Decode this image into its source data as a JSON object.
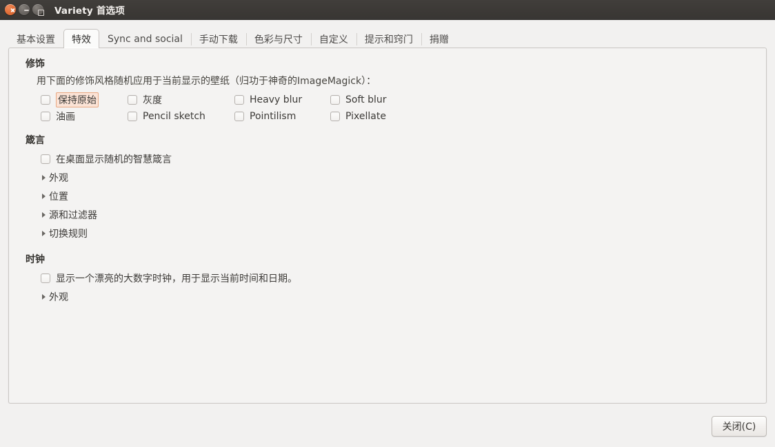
{
  "window": {
    "title": "Variety 首选项",
    "controls": {
      "close": "close-icon",
      "minimize": "minimize-icon",
      "maximize": "maximize-icon"
    }
  },
  "tabs": [
    {
      "label": "基本设置",
      "active": false
    },
    {
      "label": "特效",
      "active": true
    },
    {
      "label": "Sync and social",
      "active": false
    },
    {
      "label": "手动下载",
      "active": false
    },
    {
      "label": "色彩与尺寸",
      "active": false
    },
    {
      "label": "自定义",
      "active": false
    },
    {
      "label": "提示和窍门",
      "active": false
    },
    {
      "label": "捐赠",
      "active": false
    }
  ],
  "sections": {
    "filters": {
      "title": "修饰",
      "description": "用下面的修饰风格随机应用于当前显示的壁纸（归功于神奇的ImageMagick）：",
      "options": [
        {
          "label": "保持原始",
          "checked": false,
          "focused": true
        },
        {
          "label": "灰度",
          "checked": false,
          "focused": false
        },
        {
          "label": "Heavy blur",
          "checked": false,
          "focused": false
        },
        {
          "label": "Soft blur",
          "checked": false,
          "focused": false
        },
        {
          "label": "油画",
          "checked": false,
          "focused": false
        },
        {
          "label": "Pencil sketch",
          "checked": false,
          "focused": false
        },
        {
          "label": "Pointilism",
          "checked": false,
          "focused": false
        },
        {
          "label": "Pixellate",
          "checked": false,
          "focused": false
        }
      ]
    },
    "quotes": {
      "title": "箴言",
      "checkbox": {
        "label": "在桌面显示随机的智慧箴言",
        "checked": false
      },
      "expanders": [
        {
          "label": "外观",
          "expanded": false
        },
        {
          "label": "位置",
          "expanded": false
        },
        {
          "label": "源和过滤器",
          "expanded": false
        },
        {
          "label": "切换规则",
          "expanded": false
        }
      ]
    },
    "clock": {
      "title": "时钟",
      "checkbox": {
        "label": "显示一个漂亮的大数字时钟，用于显示当前时间和日期。",
        "checked": false
      },
      "expanders": [
        {
          "label": "外观",
          "expanded": false
        }
      ]
    }
  },
  "footer": {
    "close_button": "关闭(C)"
  },
  "colors": {
    "titlebar": "#3c3936",
    "close_button_orange": "#e4713a",
    "content_bg": "#f4f3f2",
    "window_bg": "#f2f1f0",
    "focus_highlight_bg": "#fbe3d6",
    "focus_highlight_border": "#e8a882",
    "text": "#3c3a37"
  }
}
